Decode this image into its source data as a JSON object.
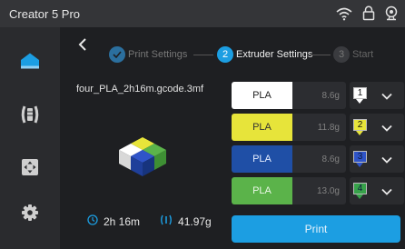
{
  "app": {
    "title": "Creator 5 Pro"
  },
  "status_icons": [
    "wifi-icon",
    "lock-icon",
    "webcam-icon"
  ],
  "sidebar": {
    "items": [
      {
        "icon": "home-icon",
        "active": true
      },
      {
        "icon": "filament-icon",
        "active": false
      },
      {
        "icon": "move-icon",
        "active": false
      },
      {
        "icon": "settings-icon",
        "active": false
      }
    ]
  },
  "stepper": {
    "steps": [
      {
        "label": "Print Settings",
        "number": "",
        "state": "done"
      },
      {
        "label": "Extruder Settings",
        "number": "2",
        "state": "active"
      },
      {
        "label": "Start",
        "number": "3",
        "state": "pending"
      }
    ]
  },
  "file": {
    "name": "four_PLA_2h16m.gcode.3mf"
  },
  "stats": {
    "time": "2h 16m",
    "filament": "41.97g"
  },
  "materials": [
    {
      "material": "PLA",
      "weight": "8.6g",
      "color": "#ffffff",
      "text_color": "#222222",
      "slot": "1",
      "slot_color": "#ffffff"
    },
    {
      "material": "PLA",
      "weight": "11.8g",
      "color": "#e7e43a",
      "text_color": "#333333",
      "slot": "2",
      "slot_color": "#e7e43a"
    },
    {
      "material": "PLA",
      "weight": "8.6g",
      "color": "#1f4fa6",
      "text_color": "#e6eeff",
      "slot": "3",
      "slot_color": "#2f54c8"
    },
    {
      "material": "PLA",
      "weight": "13.0g",
      "color": "#5bb34a",
      "text_color": "#eaf7e6",
      "slot": "4",
      "slot_color": "#37a24a"
    }
  ],
  "actions": {
    "print": "Print"
  },
  "colors": {
    "accent": "#1c9ee2",
    "background": "#1e1f22",
    "sidebar": "#2a2b2e",
    "topbar": "#343538"
  }
}
